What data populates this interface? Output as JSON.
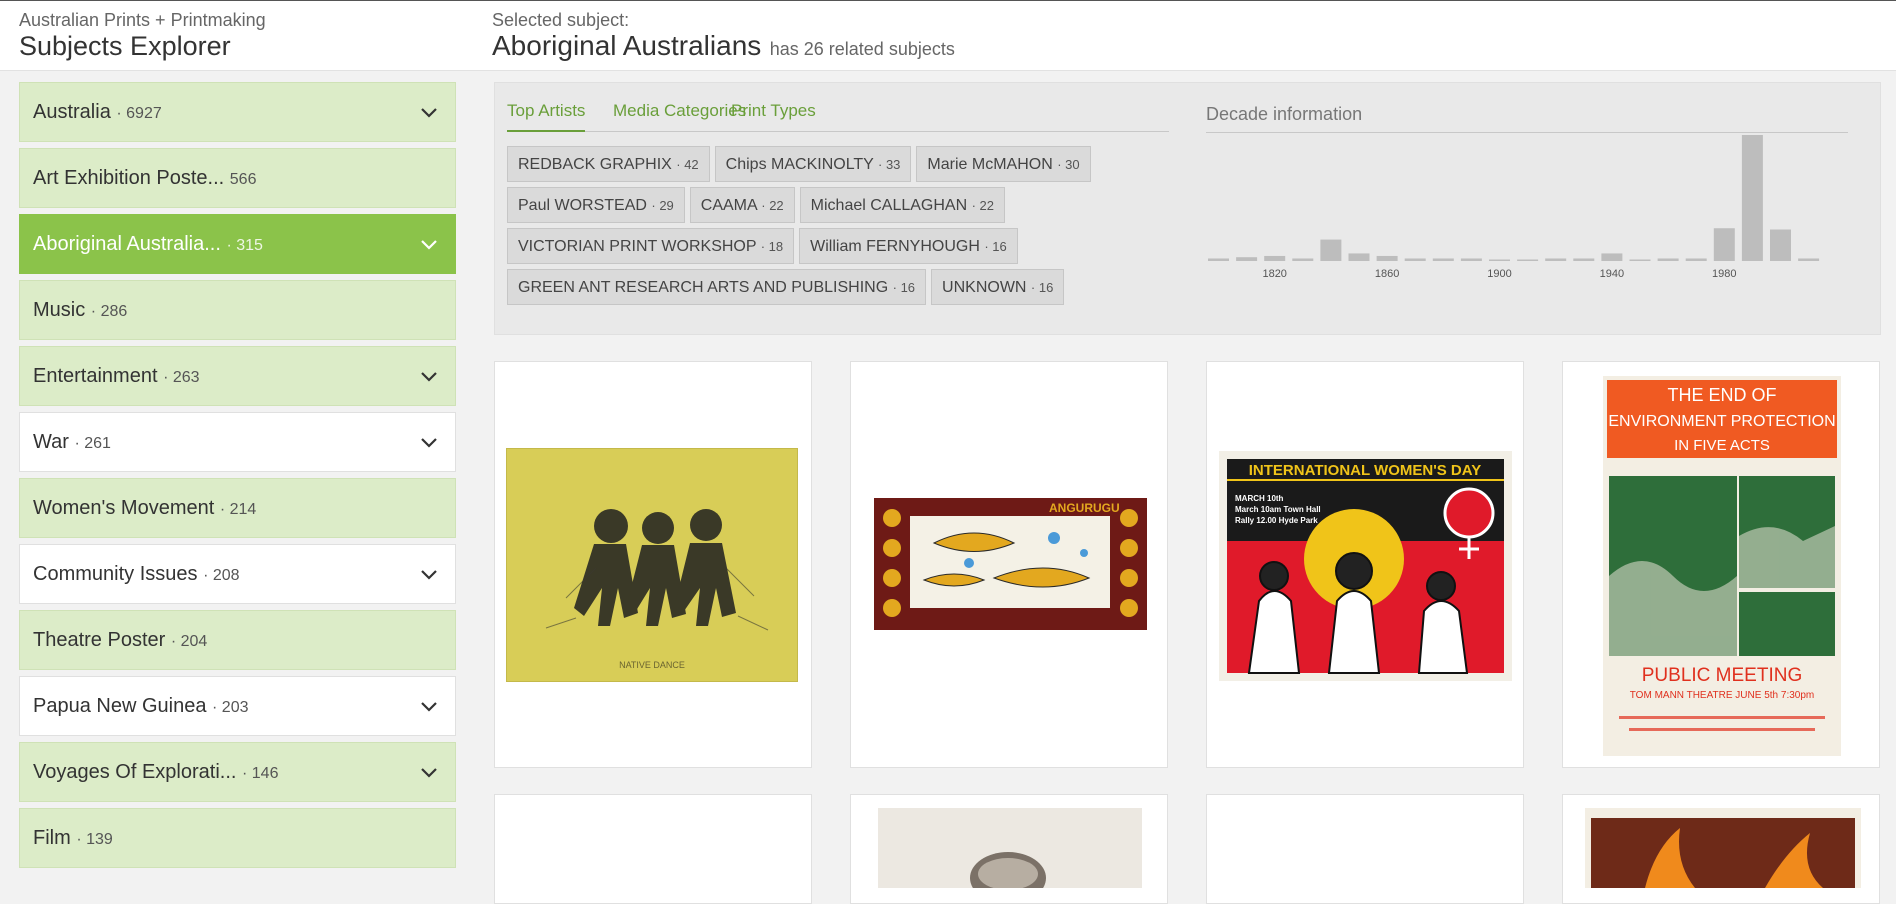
{
  "header": {
    "brand_sub": "Australian Prints + Printmaking",
    "brand_title": "Subjects Explorer",
    "selected_label": "Selected subject:",
    "selected_name": "Aboriginal Australians",
    "selected_related": "has 26 related subjects"
  },
  "sidebar": {
    "items": [
      {
        "label": "Australia",
        "count": "· 6927",
        "chevron": true,
        "style": "green"
      },
      {
        "label": "Art Exhibition Poste...",
        "count": " 566",
        "chevron": false,
        "style": "green"
      },
      {
        "label": "Aboriginal Australia...",
        "count": " · 315",
        "chevron": true,
        "style": "active"
      },
      {
        "label": "Music",
        "count": "· 286",
        "chevron": false,
        "style": "green"
      },
      {
        "label": "Entertainment",
        "count": "· 263",
        "chevron": true,
        "style": "green"
      },
      {
        "label": "War",
        "count": "· 261",
        "chevron": true,
        "style": "white"
      },
      {
        "label": "Women's Movement",
        "count": "· 214",
        "chevron": false,
        "style": "green"
      },
      {
        "label": "Community Issues",
        "count": "· 208",
        "chevron": true,
        "style": "white"
      },
      {
        "label": "Theatre Poster",
        "count": "· 204",
        "chevron": false,
        "style": "green"
      },
      {
        "label": "Papua New Guinea",
        "count": "· 203",
        "chevron": true,
        "style": "white"
      },
      {
        "label": "Voyages Of Explorati...",
        "count": " · 146",
        "chevron": true,
        "style": "green"
      },
      {
        "label": "Film",
        "count": "· 139",
        "chevron": false,
        "style": "green"
      }
    ]
  },
  "panel": {
    "tabs": [
      {
        "label": "Top Artists",
        "active": true
      },
      {
        "label": "Media Categories",
        "active": false
      },
      {
        "label": "Print Types",
        "active": false
      }
    ],
    "artists": [
      {
        "name": "REDBACK GRAPHIX",
        "count": "· 42"
      },
      {
        "name": "Chips MACKINOLTY",
        "count": "· 33"
      },
      {
        "name": "Marie McMAHON",
        "count": "· 30"
      },
      {
        "name": "Paul WORSTEAD",
        "count": "· 29"
      },
      {
        "name": "CAAMA",
        "count": "· 22"
      },
      {
        "name": "Michael CALLAGHAN",
        "count": "· 22"
      },
      {
        "name": "VICTORIAN PRINT WORKSHOP",
        "count": "· 18"
      },
      {
        "name": "William FERNYHOUGH",
        "count": "· 16"
      },
      {
        "name": "GREEN ANT RESEARCH ARTS AND PUBLISHING",
        "count": "· 16"
      },
      {
        "name": "UNKNOWN",
        "count": "· 16"
      }
    ],
    "decade_title": "Decade information"
  },
  "chart_data": {
    "type": "bar",
    "title": "Decade information",
    "categories": [
      "1800",
      "1810",
      "1820",
      "1830",
      "1840",
      "1850",
      "1860",
      "1870",
      "1880",
      "1890",
      "1900",
      "1910",
      "1920",
      "1930",
      "1940",
      "1950",
      "1960",
      "1970",
      "1980",
      "1990",
      "2000",
      "2010"
    ],
    "values": [
      2,
      3,
      4,
      2,
      17,
      6,
      4,
      2,
      2,
      2,
      1,
      1,
      2,
      2,
      6,
      1,
      2,
      2,
      26,
      100,
      25,
      2
    ],
    "tick_labels": [
      "1820",
      "1860",
      "1900",
      "1940",
      "1980"
    ],
    "bar_color": "#bdbdbd"
  },
  "gallery": {
    "items": [
      {
        "name": "native-dance-print"
      },
      {
        "name": "angurugu-print"
      },
      {
        "name": "international-womens-day-poster"
      },
      {
        "name": "end-of-environment-protection-poster"
      },
      {
        "name": "gallery-item-5"
      },
      {
        "name": "gallery-item-6"
      },
      {
        "name": "gallery-item-7"
      },
      {
        "name": "gallery-item-8"
      }
    ],
    "poster_texts": {
      "womens_day_title": "INTERNATIONAL WOMEN'S DAY",
      "womens_day_l1": "MARCH 10th",
      "womens_day_l2": "March 10am Town Hall",
      "womens_day_l3": "Rally 12.00 Hyde Park",
      "angurugu_title": "ANGURUGU",
      "env_title_1": "THE END OF",
      "env_title_2": "ENVIRONMENT PROTECTION",
      "env_title_3": "IN FIVE ACTS",
      "env_public": "PUBLIC MEETING",
      "env_venue": "TOM MANN THEATRE  JUNE 5th  7:30pm"
    }
  },
  "colors": {
    "accent": "#8bc34a",
    "tab_green": "#6a9f3a",
    "sidebar_green": "#dcecc8"
  }
}
